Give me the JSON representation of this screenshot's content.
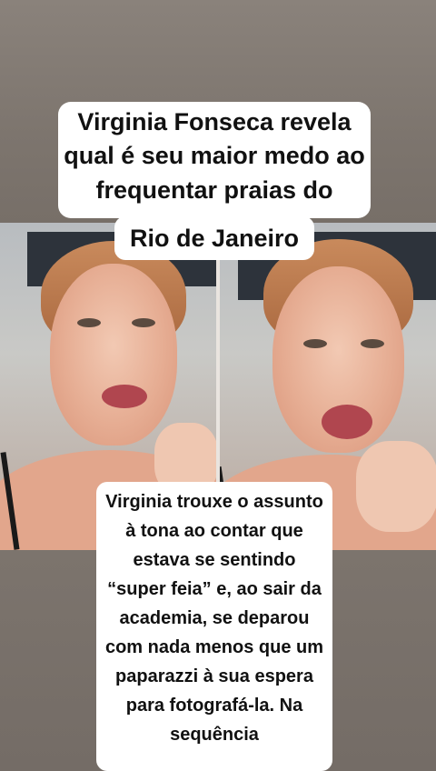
{
  "title_lines": [
    "Virginia Fonseca revela qual é seu maior medo ao frequentar praias do",
    "Rio de Janeiro"
  ],
  "body_text": "Virginia trouxe o assunto à tona ao contar que estava se sentindo “super feia” e, ao sair da academia, se deparou com nada menos que um paparazzi à sua espera para fotografá-la. Na sequência",
  "colors": {
    "caption_bg": "#ffffff",
    "caption_text": "#111111"
  }
}
